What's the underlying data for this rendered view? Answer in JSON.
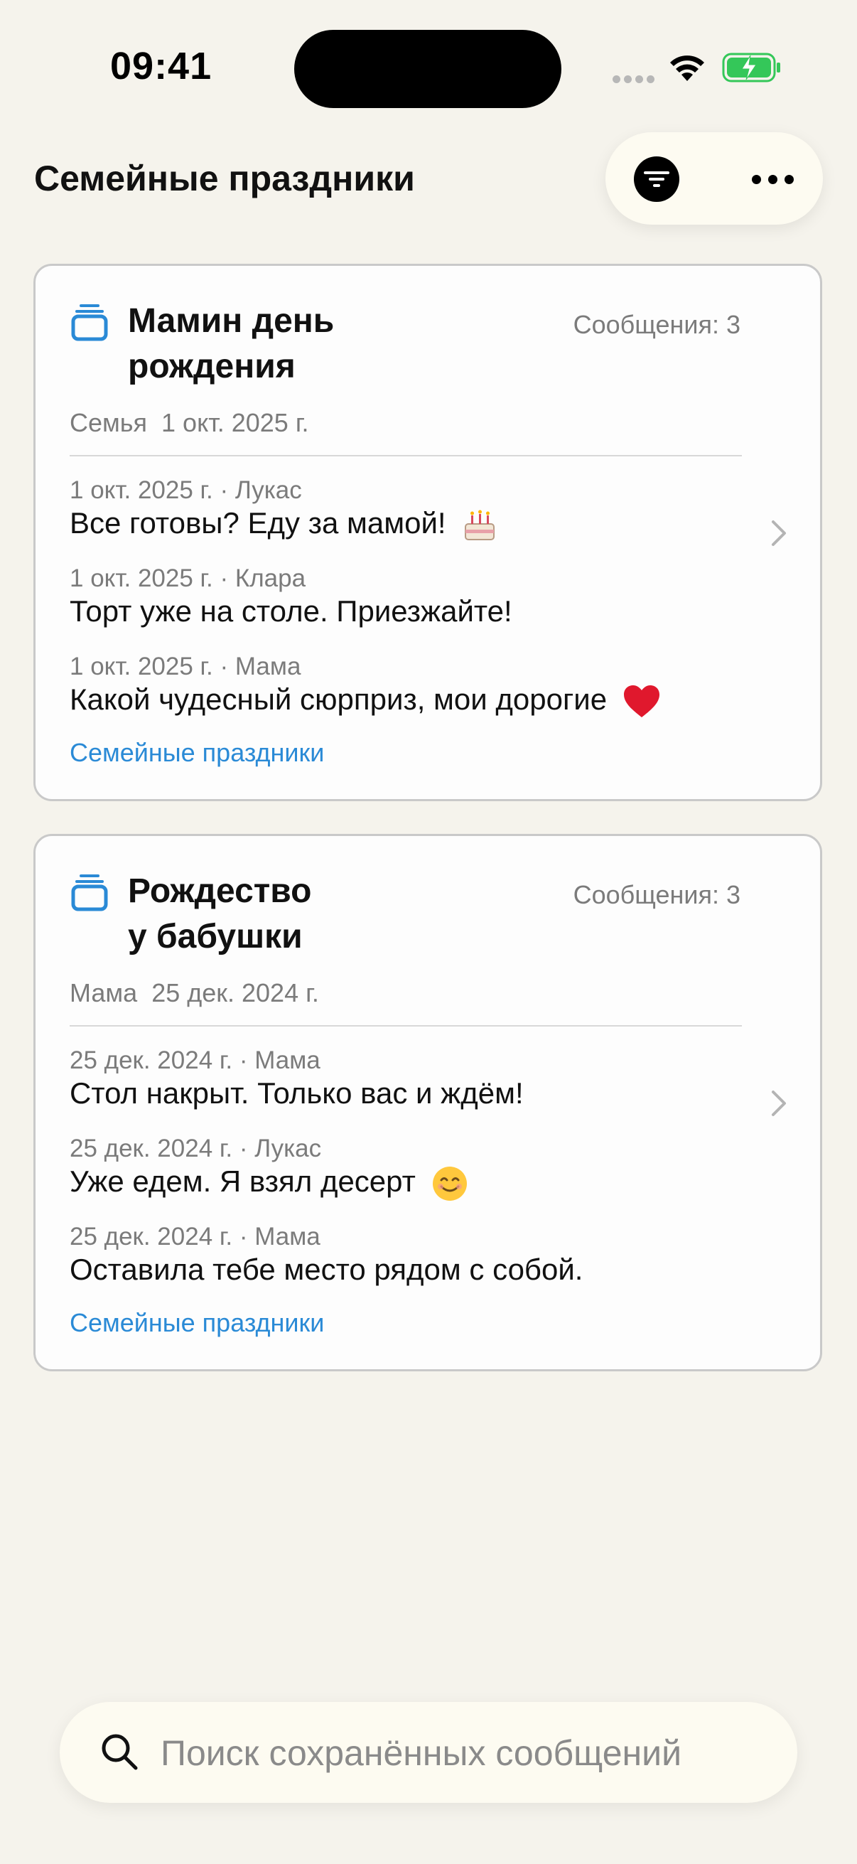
{
  "status_bar": {
    "time": "09:41"
  },
  "header": {
    "title": "Семейные праздники"
  },
  "toolbar": {
    "filter_icon": "filter-lines-icon",
    "more_icon": "ellipsis-icon"
  },
  "threads": [
    {
      "title_line1": "Мамин день",
      "title_line2": "рождения",
      "count": "Сообщения: 3",
      "meta_owner": "Семья",
      "meta_date": "1 окт. 2025 г.",
      "messages": [
        {
          "head": "1 окт. 2025 г. · Лукас",
          "text": "Все готовы? Еду за мамой!",
          "emoji": "cake-emoji"
        },
        {
          "head": "1 окт. 2025 г. · Клара",
          "text": "Торт уже на столе. Приезжайте!"
        },
        {
          "head": "1 окт. 2025 г. · Мама",
          "text": "Какой чудесный сюрприз, мои дорогие",
          "emoji": "heart-emoji"
        }
      ],
      "collection": "Семейные праздники"
    },
    {
      "title_line1": "Рождество",
      "title_line2": "у бабушки",
      "count": "Сообщения: 3",
      "meta_owner": "Мама",
      "meta_date": "25 дек. 2024 г.",
      "messages": [
        {
          "head": "25 дек. 2024 г. · Мама",
          "text": "Стол накрыт. Только вас и ждём!"
        },
        {
          "head": "25 дек. 2024 г. · Лукас",
          "text": "Уже едем. Я взял десерт",
          "emoji": "smile-emoji"
        },
        {
          "head": "25 дек. 2024 г. · Мама",
          "text": "Оставила тебе место рядом с собой."
        }
      ],
      "collection": "Семейные праздники"
    }
  ],
  "search": {
    "placeholder": "Поиск сохранённых сообщений",
    "value": ""
  },
  "colors": {
    "background": "#f5f3ec",
    "accent": "#2a8ad6",
    "link": "#2a8ad6"
  }
}
